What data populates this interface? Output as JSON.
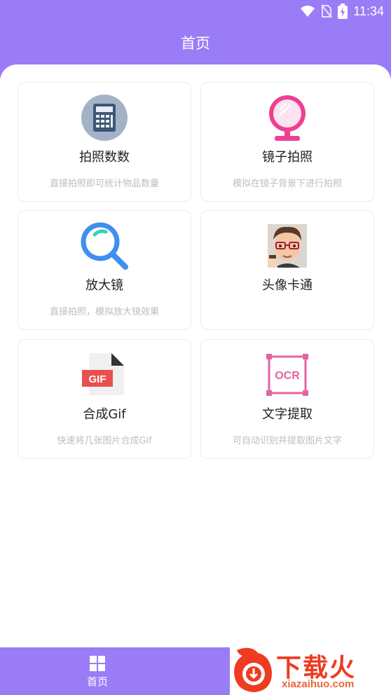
{
  "status": {
    "time": "11:34"
  },
  "header": {
    "title": "首页"
  },
  "cards": [
    {
      "title": "拍照数数",
      "desc": "直接拍照即可统计物品数量",
      "icon": "calculator-icon"
    },
    {
      "title": "镜子拍照",
      "desc": "模拟在镜子背景下进行拍照",
      "icon": "mirror-icon"
    },
    {
      "title": "放大镜",
      "desc": "直接拍照，模拟放大镜效果",
      "icon": "magnifier-icon"
    },
    {
      "title": "头像卡通",
      "desc": "",
      "icon": "cartoon-avatar-icon"
    },
    {
      "title": "合成Gif",
      "desc": "快速将几张图片合成Gif",
      "icon": "gif-file-icon"
    },
    {
      "title": "文字提取",
      "desc": "可自动识别并提取图片文字",
      "icon": "ocr-icon"
    }
  ],
  "bottom_nav": {
    "items": [
      {
        "label": "首页",
        "icon": "grid-icon"
      }
    ]
  },
  "watermark": {
    "text": "下载火",
    "sub": "xiazaihuo.com"
  },
  "colors": {
    "primary": "#9a7cf7",
    "pink": "#ee3f93",
    "blue": "#3f8ff0",
    "teal": "#33d2b8",
    "gif_red": "#e94f4f",
    "ocr_pink": "#e2669f"
  }
}
